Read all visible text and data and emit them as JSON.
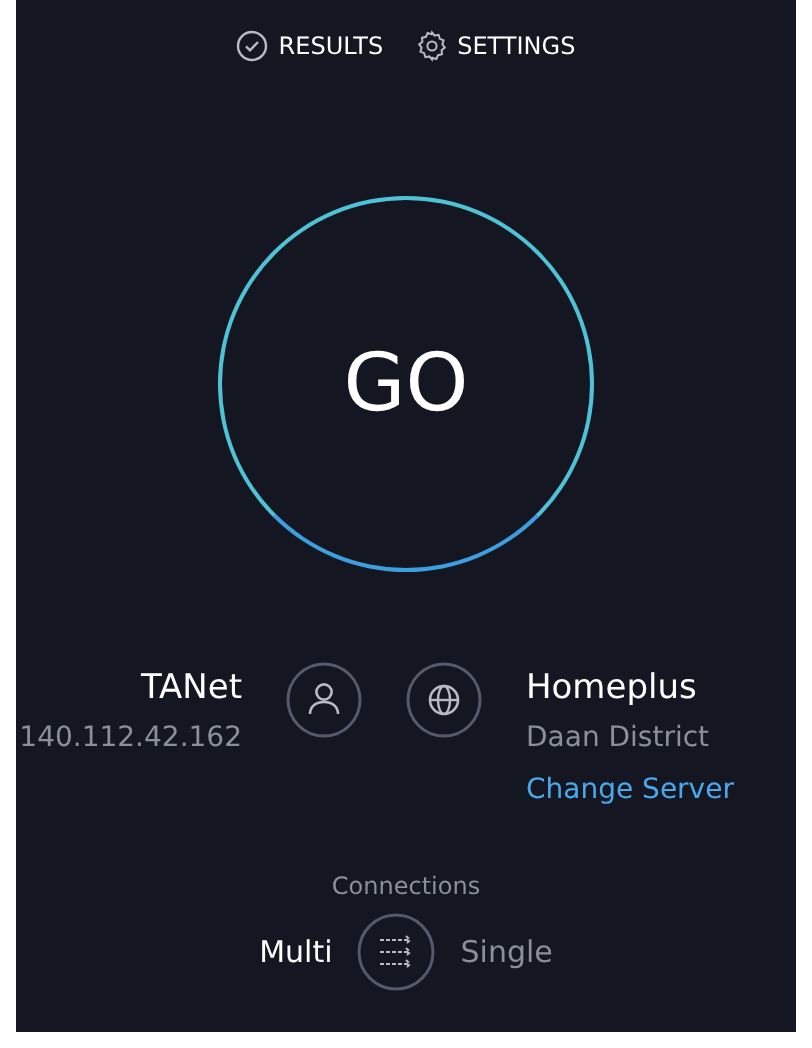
{
  "nav": [
    {
      "kind": "results",
      "label": "RESULTS"
    },
    {
      "kind": "settings",
      "label": "SETTINGS"
    }
  ],
  "go_button": {
    "label": "GO"
  },
  "provider": {
    "name": "TANet",
    "ip": "140.112.42.162"
  },
  "server": {
    "name": "Homeplus",
    "location": "Daan District",
    "link": "Change Server"
  },
  "connections": {
    "label": "Connections",
    "options": [
      {
        "label": "Multi",
        "selected": true
      },
      {
        "label": "Single",
        "selected": false
      }
    ]
  }
}
